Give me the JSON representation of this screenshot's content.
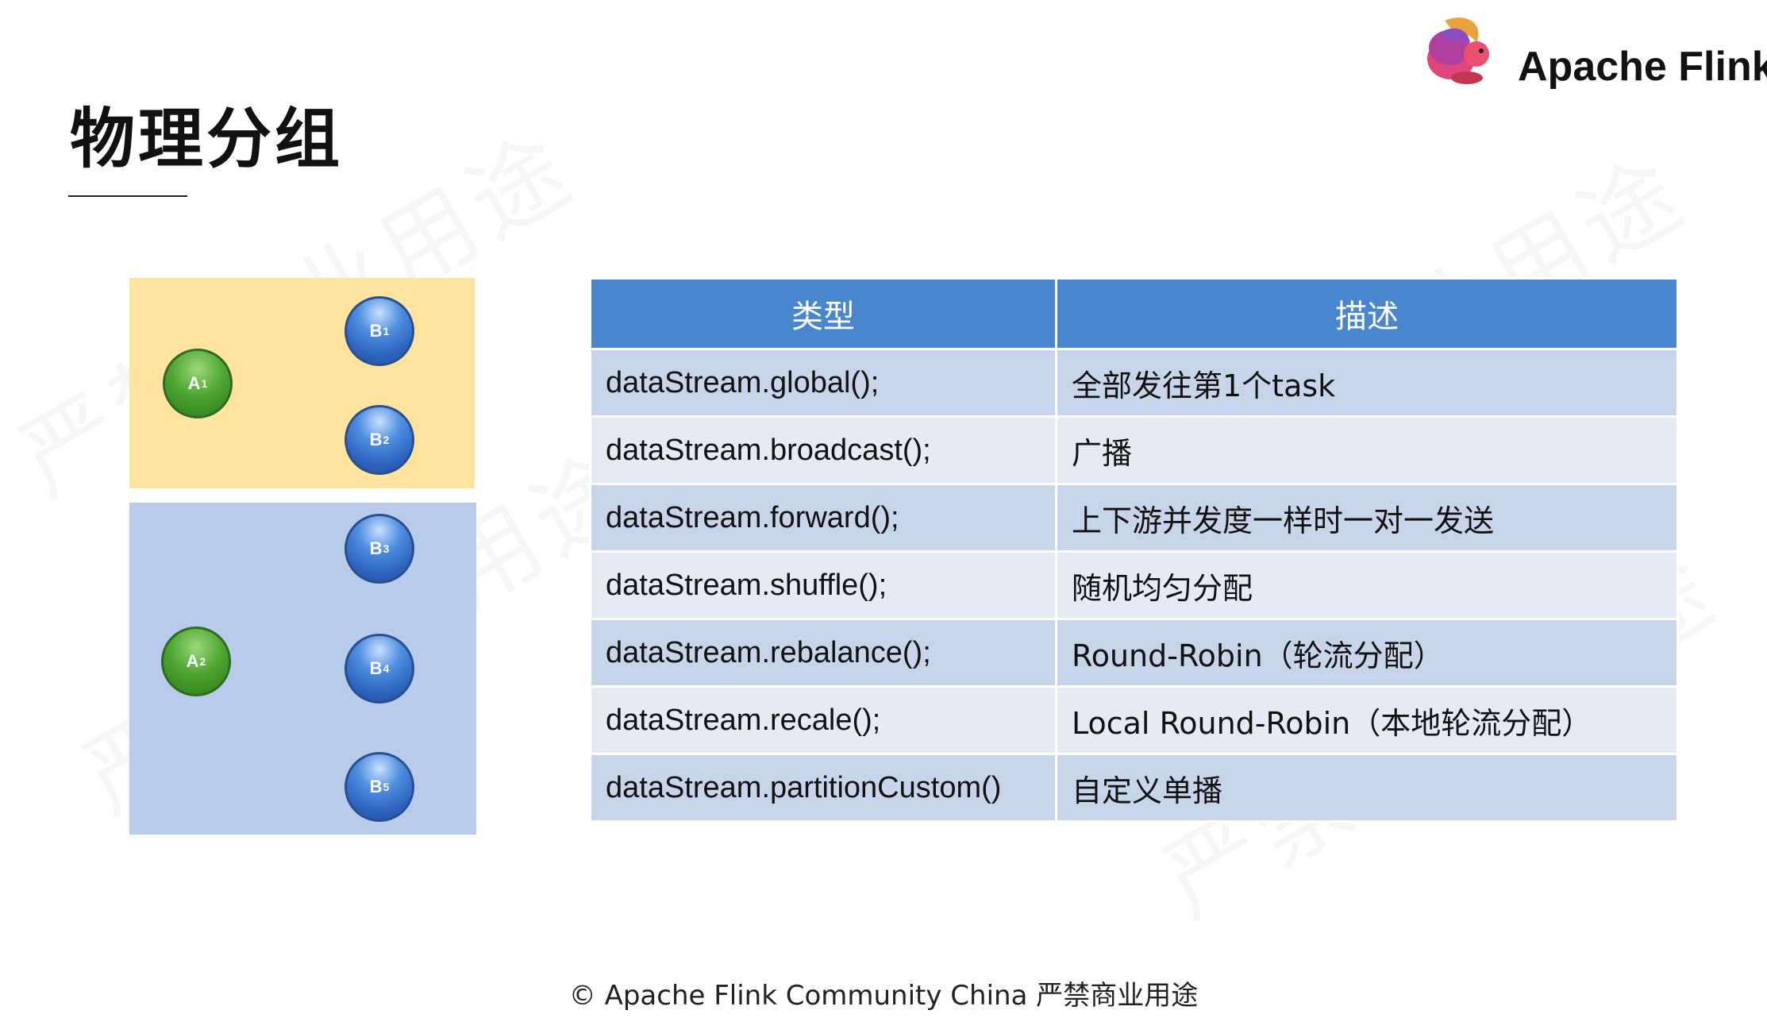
{
  "title": "物理分组",
  "logo": {
    "text": "Apache Flink",
    "icon": "squirrel-logo-icon"
  },
  "watermark": "严禁商业用途",
  "diagram": {
    "panel_colors": {
      "yellow": "#fee49e",
      "blue": "#b8cbea"
    },
    "nodes": [
      {
        "letter": "A",
        "sub": "1",
        "color": "green"
      },
      {
        "letter": "B",
        "sub": "1",
        "color": "blue"
      },
      {
        "letter": "B",
        "sub": "2",
        "color": "blue"
      },
      {
        "letter": "B",
        "sub": "3",
        "color": "blue"
      },
      {
        "letter": "A",
        "sub": "2",
        "color": "green"
      },
      {
        "letter": "B",
        "sub": "4",
        "color": "blue"
      },
      {
        "letter": "B",
        "sub": "5",
        "color": "blue"
      }
    ]
  },
  "table": {
    "header_color": "#4a86ce",
    "headers": [
      "类型",
      "描述"
    ],
    "rows": [
      [
        "dataStream.global();",
        "全部发往第1个task"
      ],
      [
        "dataStream.broadcast();",
        "广播"
      ],
      [
        "dataStream.forward();",
        "上下游并发度一样时一对一发送"
      ],
      [
        "dataStream.shuffle();",
        "随机均匀分配"
      ],
      [
        "dataStream.rebalance();",
        "Round-Robin（轮流分配）"
      ],
      [
        "dataStream.recale();",
        "Local Round-Robin（本地轮流分配）"
      ],
      [
        "dataStream.partitionCustom()",
        "自定义单播"
      ]
    ]
  },
  "footer": "© Apache Flink Community China  严禁商业用途"
}
